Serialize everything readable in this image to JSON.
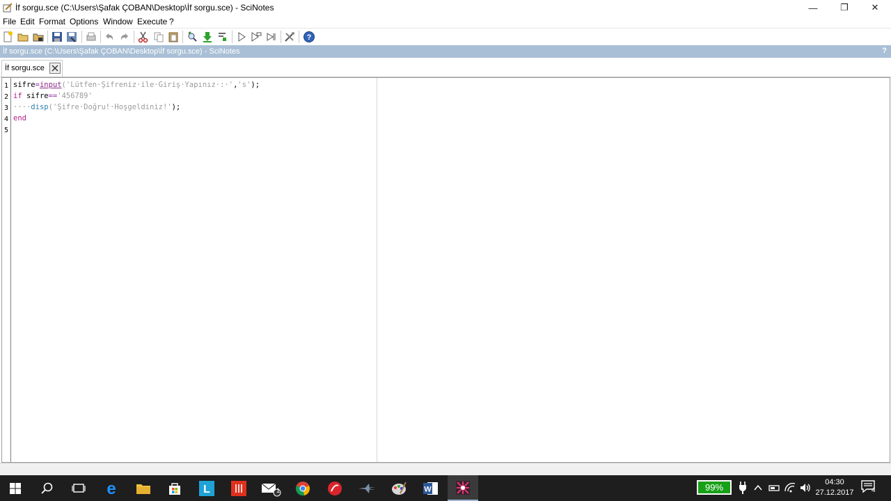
{
  "window": {
    "title": "İf sorgu.sce (C:\\Users\\Şafak ÇOBAN\\Desktop\\İf sorgu.sce) - SciNotes",
    "minimize": "—",
    "restore": "❐",
    "close": "✕"
  },
  "menu": {
    "file": "File",
    "edit": "Edit",
    "format": "Format",
    "options": "Options",
    "window": "Window",
    "execute": "Execute",
    "help": "?"
  },
  "pathbar": {
    "text": "İf sorgu.sce (C:\\Users\\Şafak ÇOBAN\\Desktop\\İf sorgu.sce) - SciNotes",
    "help": "?"
  },
  "tab": {
    "label": "İf sorgu.sce"
  },
  "editor": {
    "line_numbers": [
      "1",
      "2",
      "3",
      "4",
      "5"
    ],
    "line1": {
      "var": "sifre",
      "eq": "=",
      "fn": "input",
      "open": "(",
      "str1": "'Lütfen·Şifreniz·ile·Giriş·Yapınız·:·'",
      "comma": ",",
      "str2": "'s'",
      "close": ");"
    },
    "line2": {
      "kw": "if",
      "rest": " sifre",
      "op": "==",
      "str": "'456789'"
    },
    "line3": {
      "indent": "····",
      "fn": "disp",
      "open": "(",
      "str": "'Şifre·Doğru!·Hoşgeldiniz!'",
      "close": ");"
    },
    "line4": {
      "kw": "end"
    }
  },
  "taskbar": {
    "battery": "99%",
    "battery_level": 0.99,
    "time": "04:30",
    "date": "27.12.2017",
    "notifications": "4",
    "mail_badge": "1"
  },
  "colors": {
    "pathbar_bg": "#a9bfd6",
    "taskbar_bg": "#1e1e1e",
    "keyword": "#b01c8a",
    "string": "#9b9b9b",
    "battery_fill": "#18a018"
  }
}
